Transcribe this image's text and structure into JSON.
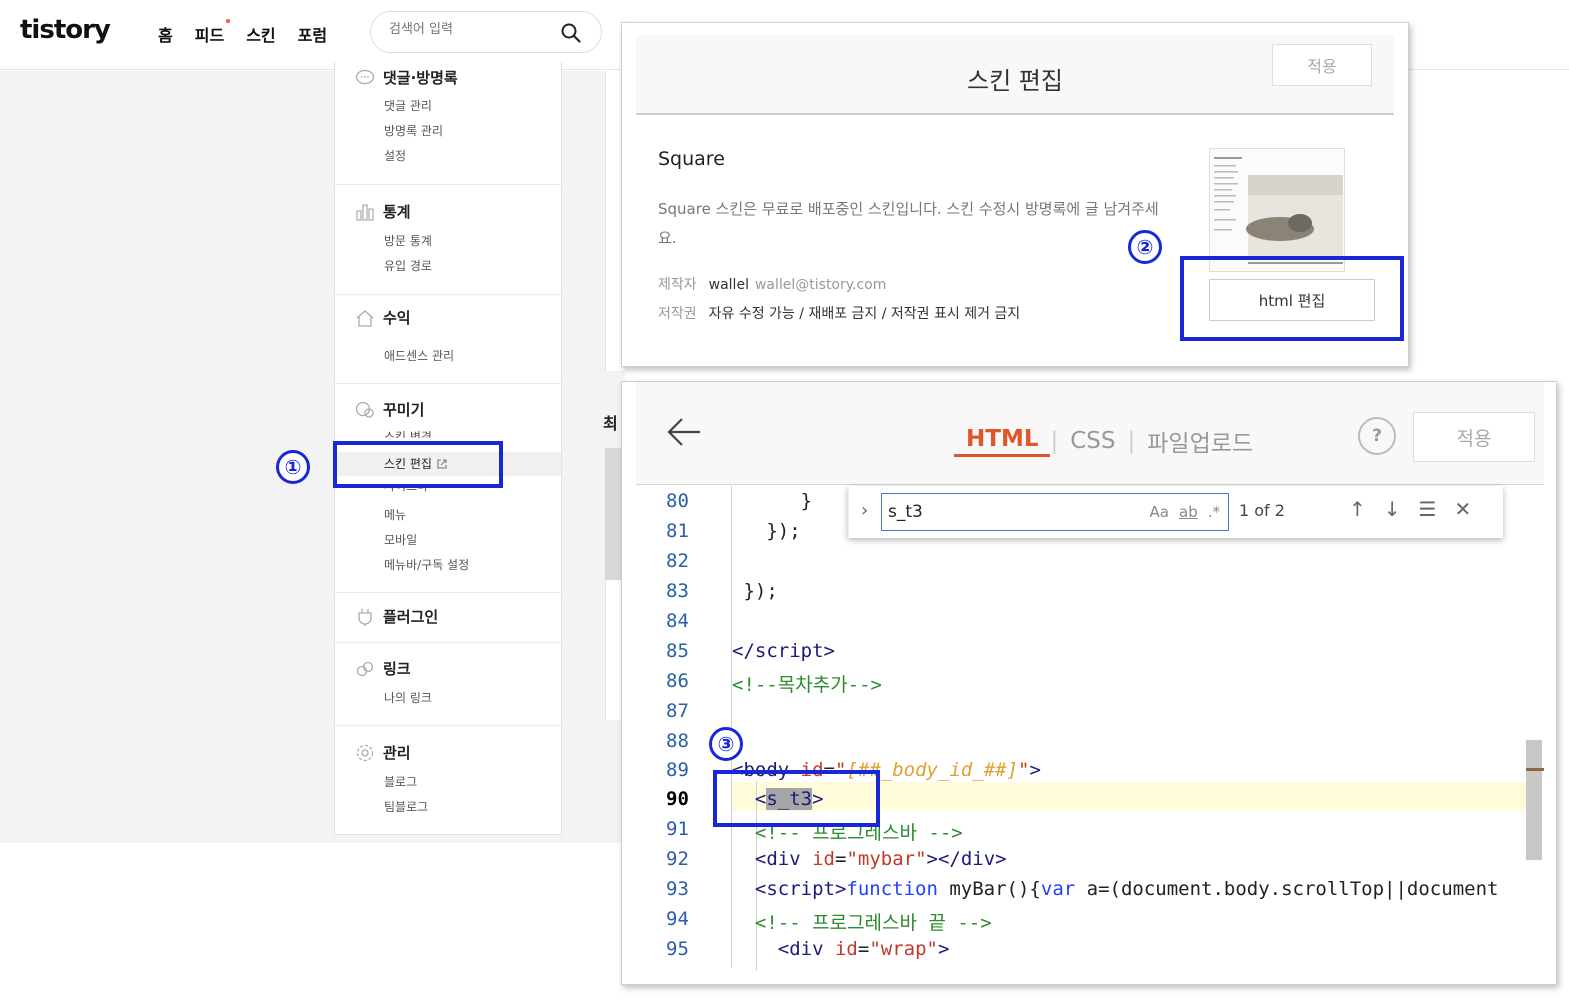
{
  "topbar": {
    "logo": "tistory",
    "nav": [
      "홈",
      "피드",
      "스킨",
      "포럼"
    ],
    "search_placeholder": "검색어 입력"
  },
  "sidebar": {
    "sections": [
      {
        "title": "댓글·방명록",
        "items": [
          "댓글 관리",
          "방명록 관리",
          "설정"
        ]
      },
      {
        "title": "통계",
        "items": [
          "방문 통계",
          "유입 경로"
        ]
      },
      {
        "title": "수익",
        "items": [
          "애드센스 관리"
        ]
      },
      {
        "title": "꾸미기",
        "items": [
          "스킨 변경",
          "스킨 편집",
          "사이드바",
          "메뉴",
          "모바일",
          "메뉴바/구독 설정"
        ]
      },
      {
        "title": "플러그인",
        "items": []
      },
      {
        "title": "링크",
        "items": [
          "나의 링크"
        ]
      },
      {
        "title": "관리",
        "items": [
          "블로그",
          "팀블로그"
        ]
      }
    ],
    "cut_text": "최"
  },
  "skin_panel": {
    "title": "스킨 편집",
    "apply_label": "적용",
    "skin_name": "Square",
    "description": "Square 스킨은 무료로 배포중인 스킨입니다. 스킨 수정시 방명록에 글 남겨주세요.",
    "author_label": "제작자",
    "author_name": "wallel",
    "author_email": "wallel@tistory.com",
    "copyright_label": "저작권",
    "copyright_value": "자유 수정 가능 / 재배포 금지 / 저작권 표시 제거 금지",
    "html_edit_label": "html 편집"
  },
  "editor": {
    "tabs": [
      "HTML",
      "CSS",
      "파일업로드"
    ],
    "active_tab": "HTML",
    "help_label": "?",
    "apply_label": "적용",
    "find": {
      "query": "s_t3",
      "opt_case": "Aa",
      "opt_word": "ab",
      "opt_regex": ".*",
      "count": "1 of 2"
    },
    "line_numbers": [
      "80",
      "81",
      "82",
      "83",
      "84",
      "85",
      "86",
      "87",
      "88",
      "89",
      "90",
      "91",
      "92",
      "93",
      "94",
      "95"
    ],
    "current_line": "90"
  },
  "annotations": [
    "①",
    "②",
    "③"
  ],
  "colors": {
    "annotation": "#1a27d6",
    "tab_active": "#e0562b",
    "find_border": "#3a7bd5"
  }
}
